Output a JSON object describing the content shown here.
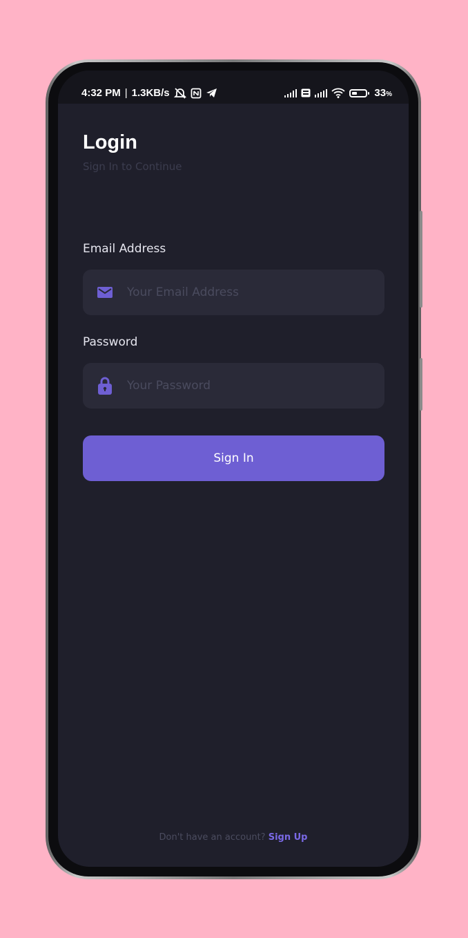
{
  "status_bar": {
    "time": "4:32 PM",
    "separator": "|",
    "net_speed": "1.3KB/s",
    "battery_pct": "33",
    "battery_unit": "%",
    "icons": [
      "alarm-off-icon",
      "nfc-icon",
      "telegram-icon",
      "signal-icon",
      "volte-icon",
      "4g-signal-icon",
      "wifi-icon",
      "battery-icon"
    ]
  },
  "header": {
    "title": "Login",
    "subtitle": "Sign In to Continue"
  },
  "form": {
    "email_label": "Email Address",
    "email_placeholder": "Your Email Address",
    "email_value": "",
    "password_label": "Password",
    "password_placeholder": "Your Password",
    "password_value": "",
    "submit_label": "Sign In"
  },
  "footer": {
    "prompt": "Don't have an account?",
    "link": "Sign Up"
  },
  "colors": {
    "background": "#ffb3c6",
    "screen": "#1f1f2b",
    "field": "#2a2a38",
    "accent": "#6e5fd3",
    "link": "#7a69e6"
  }
}
